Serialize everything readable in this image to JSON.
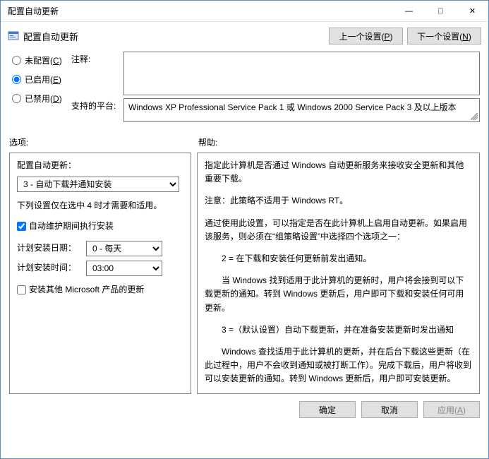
{
  "window": {
    "title": "配置自动更新"
  },
  "header": {
    "title": "配置自动更新",
    "prev_label": "上一个设置",
    "prev_hotkey": "P",
    "next_label": "下一个设置",
    "next_hotkey": "N"
  },
  "radios": {
    "not_configured": "未配置",
    "not_configured_hotkey": "C",
    "enabled": "已启用",
    "enabled_hotkey": "E",
    "disabled": "已禁用",
    "disabled_hotkey": "D",
    "selected": "enabled"
  },
  "comment": {
    "label": "注释:",
    "value": ""
  },
  "supported": {
    "label": "支持的平台:",
    "value": "Windows XP Professional Service Pack 1 或 Windows 2000 Service Pack 3 及以上版本"
  },
  "sections": {
    "options": "选项:",
    "help": "帮助:"
  },
  "options": {
    "config_label": "配置自动更新：",
    "config_value": "3 - 自动下载并通知安装",
    "note": "下列设置仅在选中 4 时才需要和适用。",
    "maint_check_label": "自动维护期间执行安装",
    "maint_checked": true,
    "day_label": "计划安装日期：",
    "day_value": "0 - 每天",
    "time_label": "计划安装时间：",
    "time_value": "03:00",
    "other_products_label": "安装其他 Microsoft 产品的更新",
    "other_products_checked": false
  },
  "help": {
    "p1": "指定此计算机是否通过 Windows 自动更新服务来接收安全更新和其他重要下载。",
    "p2": "注意：此策略不适用于 Windows RT。",
    "p3": "通过使用此设置，可以指定是否在此计算机上启用自动更新。如果启用该服务，则必须在“组策略设置”中选择四个选项之一：",
    "p4": "2 = 在下载和安装任何更新前发出通知。",
    "p5": "当 Windows 找到适用于此计算机的更新时，用户将会接到可以下载更新的通知。转到 Windows 更新后，用户即可下载和安装任何可用更新。",
    "p6": "3 =（默认设置）自动下载更新，并在准备安装更新时发出通知",
    "p7": "Windows 查找适用于此计算机的更新，并在后台下载这些更新（在此过程中，用户不会收到通知或被打断工作）。完成下载后，用户将收到可以安装更新的通知。转到 Windows 更新后，用户即可安装更新。"
  },
  "footer": {
    "ok": "确定",
    "cancel": "取消",
    "apply": "应用",
    "apply_hotkey": "A"
  }
}
